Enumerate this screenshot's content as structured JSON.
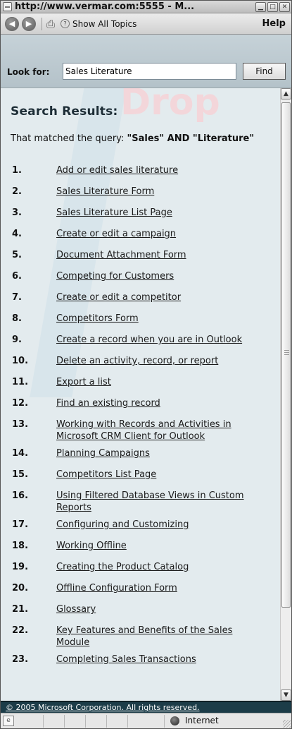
{
  "window": {
    "title": "http://www.vermar.com:5555 - M...",
    "buttons": [
      "minimize",
      "maximize",
      "close"
    ]
  },
  "toolbar": {
    "back_icon": "back-arrow-icon",
    "forward_icon": "forward-arrow-icon",
    "print_icon": "print-icon",
    "show_all_topics_label": "Show All Topics",
    "help_label": "Help"
  },
  "search": {
    "label": "Look for:",
    "value": "Sales Literature",
    "find_label": "Find"
  },
  "watermark": "Drop",
  "results": {
    "title": "Search Results:",
    "query_prefix": "That matched the query:",
    "query_text": "\"Sales\" AND \"Literature\"",
    "items": [
      {
        "num": "1.",
        "label": "Add or edit sales literature"
      },
      {
        "num": "2.",
        "label": "Sales Literature Form"
      },
      {
        "num": "3.",
        "label": "Sales Literature List Page"
      },
      {
        "num": "4.",
        "label": "Create or edit a campaign"
      },
      {
        "num": "5.",
        "label": "Document Attachment Form"
      },
      {
        "num": "6.",
        "label": "Competing for Customers"
      },
      {
        "num": "7.",
        "label": "Create or edit a competitor"
      },
      {
        "num": "8.",
        "label": "Competitors Form"
      },
      {
        "num": "9.",
        "label": "Create a record when you are in Outlook"
      },
      {
        "num": "10.",
        "label": "Delete an activity, record, or report"
      },
      {
        "num": "11.",
        "label": "Export a list"
      },
      {
        "num": "12.",
        "label": "Find an existing record"
      },
      {
        "num": "13.",
        "label": "Working with Records and Activities in Microsoft CRM Client for Outlook"
      },
      {
        "num": "14.",
        "label": "Planning Campaigns"
      },
      {
        "num": "15.",
        "label": "Competitors List Page"
      },
      {
        "num": "16.",
        "label": "Using Filtered Database Views in Custom Reports"
      },
      {
        "num": "17.",
        "label": "Configuring and Customizing"
      },
      {
        "num": "18.",
        "label": "Working Offline"
      },
      {
        "num": "19.",
        "label": "Creating the Product Catalog"
      },
      {
        "num": "20.",
        "label": "Offline Configuration Form"
      },
      {
        "num": "21.",
        "label": "Glossary"
      },
      {
        "num": "22.",
        "label": "Key Features and Benefits of the Sales Module"
      },
      {
        "num": "23.",
        "label": "Completing Sales Transactions"
      }
    ]
  },
  "footer": {
    "copyright": "© 2005 Microsoft Corporation. All rights reserved."
  },
  "status": {
    "zone": "Internet"
  },
  "colors": {
    "content_bg": "#e3ebee",
    "search_panel_bg": "#b4c2c9",
    "footer_bg": "#1c3c48"
  }
}
